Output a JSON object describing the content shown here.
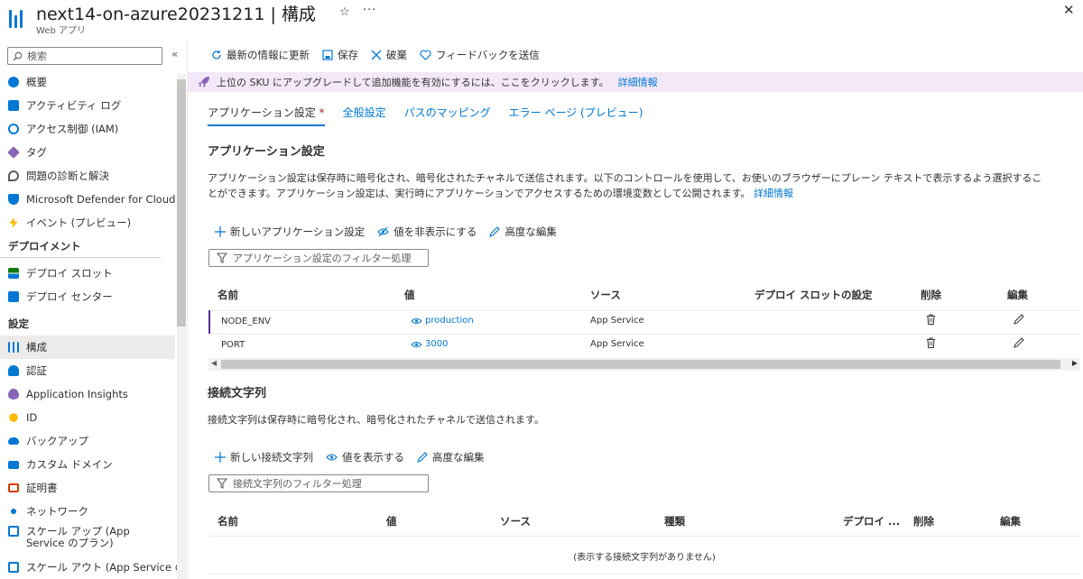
{
  "header": {
    "title": "next14-on-azure20231211 | 構成",
    "subtitle": "Web アプリ",
    "favorite_glyph": "☆",
    "more_glyph": "···",
    "close_glyph": "✕"
  },
  "sidebar": {
    "search_placeholder": "検索",
    "collapse_glyph": "«",
    "items_top": [
      {
        "label": "概要",
        "icon": "globe-icon",
        "color": "#0078d4"
      },
      {
        "label": "アクティビティ ログ",
        "icon": "log-icon",
        "color": "#0078d4"
      },
      {
        "label": "アクセス制御 (IAM)",
        "icon": "people-icon",
        "color": "#0078d4"
      },
      {
        "label": "タグ",
        "icon": "tag-icon",
        "color": "#8764b8"
      },
      {
        "label": "問題の診断と解決",
        "icon": "wrench-icon",
        "color": "#605e5c"
      },
      {
        "label": "Microsoft Defender for Cloud",
        "icon": "shield-icon",
        "color": "#0078d4"
      },
      {
        "label": "イベント (プレビュー)",
        "icon": "lightning-icon",
        "color": "#ffb900"
      }
    ],
    "section_deploy": "デプロイメント",
    "items_deploy": [
      {
        "label": "デプロイ スロット",
        "icon": "slots-icon",
        "color": "#107c10"
      },
      {
        "label": "デプロイ センター",
        "icon": "cube-icon",
        "color": "#0078d4"
      }
    ],
    "section_settings": "設定",
    "items_settings": [
      {
        "label": "構成",
        "icon": "config-icon",
        "color": "#0078d4"
      },
      {
        "label": "認証",
        "icon": "auth-icon",
        "color": "#0078d4"
      },
      {
        "label": "Application Insights",
        "icon": "insights-icon",
        "color": "#8764b8"
      },
      {
        "label": "ID",
        "icon": "key-icon",
        "color": "#ffb900"
      },
      {
        "label": "バックアップ",
        "icon": "cloud-icon",
        "color": "#0078d4"
      },
      {
        "label": "カスタム ドメイン",
        "icon": "domain-icon",
        "color": "#0078d4"
      },
      {
        "label": "証明書",
        "icon": "certificate-icon",
        "color": "#d83b01"
      },
      {
        "label": "ネットワーク",
        "icon": "network-icon",
        "color": "#0078d4"
      },
      {
        "label": "スケール アップ (App Service のプラン)",
        "icon": "scale-up-icon",
        "color": "#0078d4"
      },
      {
        "label": "スケール アウト (App Service の",
        "icon": "scale-out-icon",
        "color": "#0078d4"
      }
    ]
  },
  "toolbar": {
    "refresh": "最新の情報に更新",
    "save": "保存",
    "discard": "破棄",
    "feedback": "フィードバックを送信"
  },
  "banner": {
    "text": "上位の SKU にアップグレードして追加機能を有効にするには、ここをクリックします。",
    "link": "詳細情報"
  },
  "tabs": [
    {
      "label": "アプリケーション設定",
      "mark": "*"
    },
    {
      "label": "全般設定"
    },
    {
      "label": "パスのマッピング"
    },
    {
      "label": "エラー ページ (プレビュー)"
    }
  ],
  "app_settings": {
    "heading": "アプリケーション設定",
    "description_1": "アプリケーション設定は保存時に暗号化され、暗号化されたチャネルで送信されます。以下のコントロールを使用して、お使いのブラウザーにプレーン テキストで表示するよう選択するこ",
    "description_2": "とができます。アプリケーション設定は、実行時にアプリケーションでアクセスするための環境変数として公開されます。",
    "description_link": "詳細情報",
    "add": "新しいアプリケーション設定",
    "hide_values": "値を非表示にする",
    "advanced_edit": "高度な編集",
    "filter_placeholder": "アプリケーション設定のフィルター処理",
    "columns": {
      "name": "名前",
      "value": "値",
      "source": "ソース",
      "slot": "デプロイ スロットの設定",
      "delete": "削除",
      "edit": "編集"
    },
    "rows": [
      {
        "name": "NODE_ENV",
        "value": "production",
        "source": "App Service"
      },
      {
        "name": "PORT",
        "value": "3000",
        "source": "App Service"
      }
    ],
    "scroll_left": "◀",
    "scroll_right": "▶"
  },
  "conn_strings": {
    "heading": "接続文字列",
    "description": "接続文字列は保存時に暗号化され、暗号化されたチャネルで送信されます。",
    "add": "新しい接続文字列",
    "show_values": "値を表示する",
    "advanced_edit": "高度な編集",
    "filter_placeholder": "接続文字列のフィルター処理",
    "columns": {
      "name": "名前",
      "value": "値",
      "source": "ソース",
      "type": "種類",
      "slot": "デプロイ ...",
      "delete": "削除",
      "edit": "編集"
    },
    "empty": "(表示する接続文字列がありません)"
  },
  "colors": {
    "accent": "#0078d4",
    "banner": "#f3e8f8",
    "rocket": "#8764b8"
  }
}
